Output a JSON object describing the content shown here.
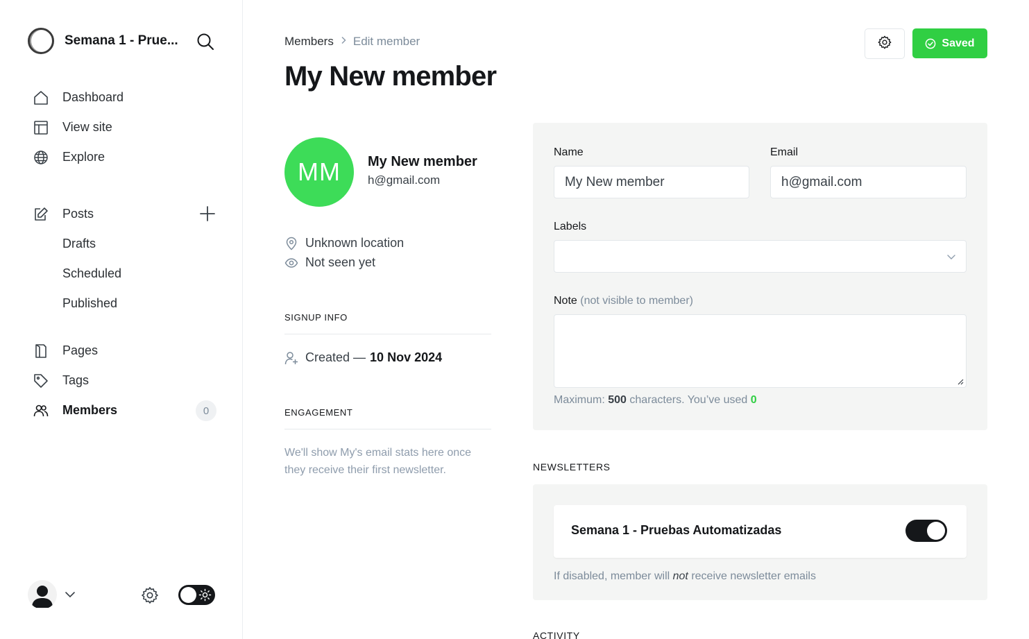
{
  "sidebar": {
    "site_title": "Semana 1 - Prue...",
    "nav": {
      "dashboard": "Dashboard",
      "view_site": "View site",
      "explore": "Explore",
      "posts": "Posts",
      "drafts": "Drafts",
      "scheduled": "Scheduled",
      "published": "Published",
      "pages": "Pages",
      "tags": "Tags",
      "members": "Members",
      "members_count": "0"
    },
    "active_item": "Members"
  },
  "header": {
    "breadcrumb": {
      "parent": "Members",
      "current": "Edit member"
    },
    "title": "My New member",
    "saved_label": "Saved"
  },
  "profile": {
    "initials": "MM",
    "name": "My New member",
    "email": "h@gmail.com",
    "location": "Unknown location",
    "last_seen": "Not seen yet",
    "avatar_color": "#3ddc58"
  },
  "signup": {
    "heading": "SIGNUP INFO",
    "created_prefix": "Created —",
    "created_date": "10 Nov 2024"
  },
  "engagement": {
    "heading": "ENGAGEMENT",
    "text": "We'll show My's email stats here once they receive their first newsletter."
  },
  "form": {
    "name_label": "Name",
    "name_value": "My New member",
    "email_label": "Email",
    "email_value": "h@gmail.com",
    "labels_label": "Labels",
    "note_label": "Note",
    "note_sub": "(not visible to member)",
    "hint_prefix": "Maximum:",
    "hint_max": "500",
    "hint_middle": "characters. You’ve used",
    "hint_used": "0"
  },
  "newsletters": {
    "heading": "NEWSLETTERS",
    "items": [
      {
        "name": "Semana 1 - Pruebas Automatizadas",
        "subscribed": true
      }
    ],
    "hint_prefix": "If disabled, member will",
    "hint_em": "not",
    "hint_suffix": "receive newsletter emails"
  },
  "activity": {
    "heading": "ACTIVITY"
  },
  "colors": {
    "accent_green": "#30cf43",
    "text_dark": "#15171a",
    "muted": "#7c8b9a"
  }
}
